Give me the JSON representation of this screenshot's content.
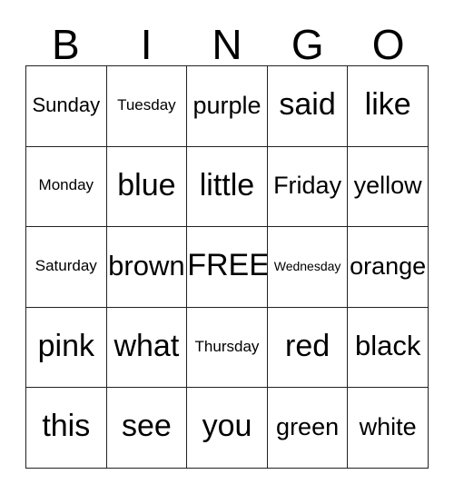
{
  "card": {
    "header_letters": [
      "B",
      "I",
      "N",
      "G",
      "O"
    ],
    "rows": [
      [
        {
          "text": "Sunday",
          "size": "sm"
        },
        {
          "text": "Tuesday",
          "size": "xs"
        },
        {
          "text": "purple",
          "size": "md"
        },
        {
          "text": "said",
          "size": "xl"
        },
        {
          "text": "like",
          "size": "xl"
        }
      ],
      [
        {
          "text": "Monday",
          "size": "xs"
        },
        {
          "text": "blue",
          "size": "xl"
        },
        {
          "text": "little",
          "size": "xl"
        },
        {
          "text": "Friday",
          "size": "md"
        },
        {
          "text": "yellow",
          "size": "md"
        }
      ],
      [
        {
          "text": "Saturday",
          "size": "xs"
        },
        {
          "text": "brown",
          "size": "lg"
        },
        {
          "text": "FREE!",
          "size": "xl"
        },
        {
          "text": "Wednesday",
          "size": "xxs"
        },
        {
          "text": "orange",
          "size": "md"
        }
      ],
      [
        {
          "text": "pink",
          "size": "xl"
        },
        {
          "text": "what",
          "size": "xl"
        },
        {
          "text": "Thursday",
          "size": "xs"
        },
        {
          "text": "red",
          "size": "xl"
        },
        {
          "text": "black",
          "size": "lg"
        }
      ],
      [
        {
          "text": "this",
          "size": "xl"
        },
        {
          "text": "see",
          "size": "xl"
        },
        {
          "text": "you",
          "size": "xl"
        },
        {
          "text": "green",
          "size": "md"
        },
        {
          "text": "white",
          "size": "md"
        }
      ]
    ],
    "free_space": "FREE!",
    "colors": {
      "text": "#000000",
      "border": "#222222",
      "background": "#ffffff"
    }
  }
}
